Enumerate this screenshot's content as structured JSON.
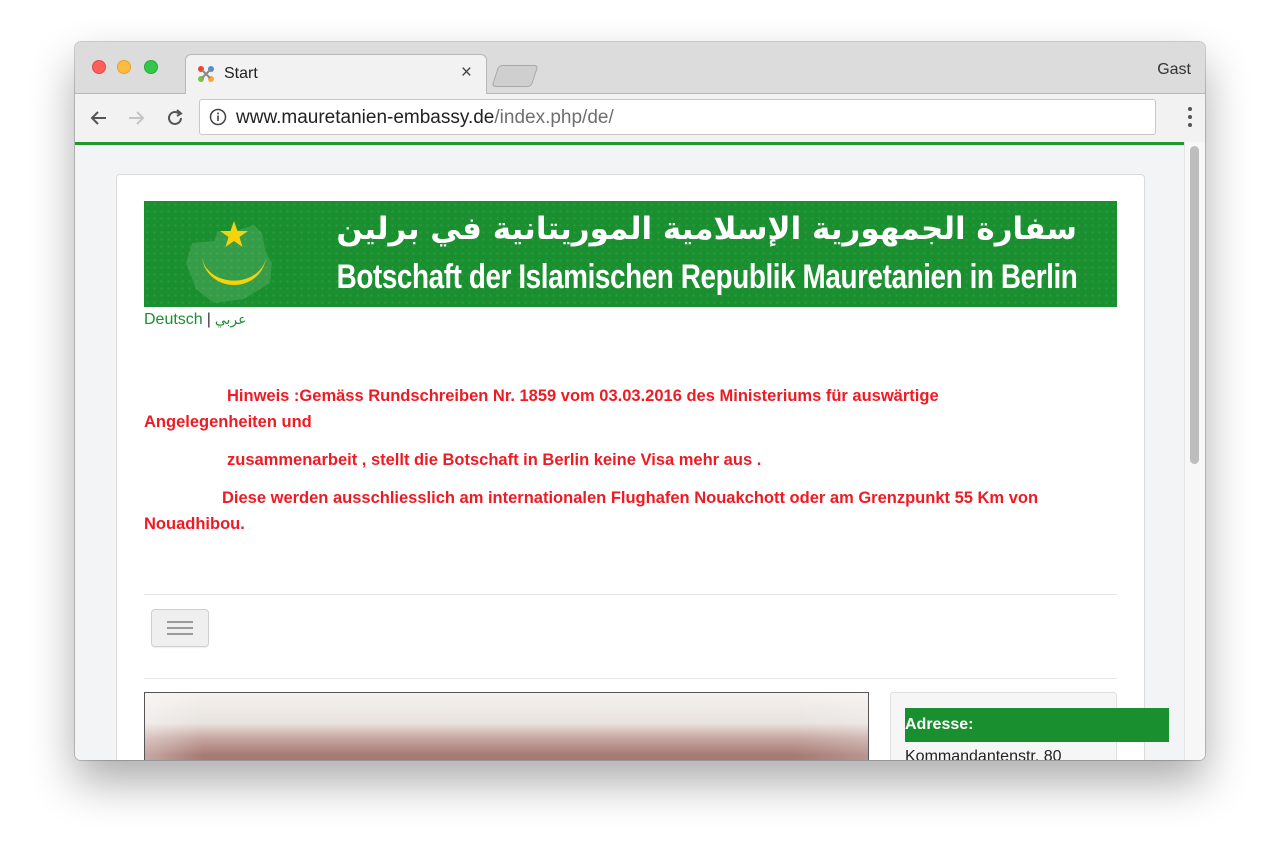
{
  "browser": {
    "tab_title": "Start",
    "tab_close": "×",
    "profile": "Gast",
    "url_host": "www.mauretanien-embassy.de",
    "url_path": "/index.php/de/"
  },
  "banner": {
    "title_ar": "سفارة الجمهورية الإسلامية الموريتانية في برلين",
    "title_de": "Botschaft der Islamischen Republik Mauretanien in Berlin"
  },
  "lang": {
    "deutsch": "Deutsch",
    "separator": "|",
    "arabic": "عربي"
  },
  "notice": {
    "line1_a": "Hinweis :Gemäss Rundschreiben Nr. 1859 vom 03.03.2016 des Ministeriums für auswärtige",
    "line1_b": "Angelegenheiten und",
    "line2": "zusammenarbeit , stellt die Botschaft in Berlin keine Visa mehr aus .",
    "line3_a": "Diese werden ausschliesslich am internationalen Flughafen Nouakchott oder am Grenzpunkt 55 Km von",
    "line3_b": "Nouadhibou."
  },
  "sidebar": {
    "address_heading": "Adresse:",
    "address_line1": "Kommandantenstr. 80"
  },
  "colors": {
    "brand_green": "#1a8f2f",
    "notice_red": "#ee1b24",
    "emblem_yellow": "#f5d20a"
  },
  "icons": [
    "joomla-favicon",
    "back-arrow-icon",
    "forward-arrow-icon",
    "reload-icon",
    "info-icon",
    "kebab-menu-icon",
    "hamburger-menu-icon",
    "crescent-star-emblem"
  ]
}
